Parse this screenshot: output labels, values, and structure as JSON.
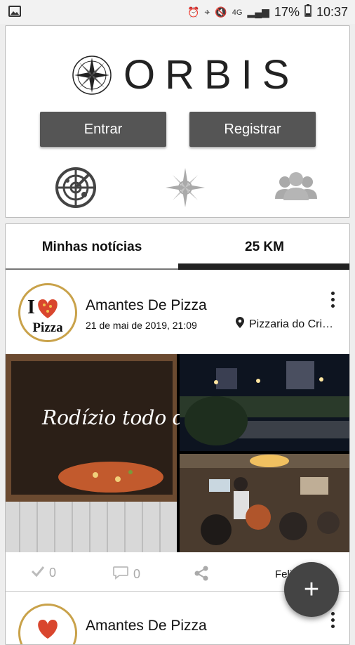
{
  "status_bar": {
    "battery": "17%",
    "time": "10:37",
    "network": "4G"
  },
  "brand": {
    "name": "ORBIS"
  },
  "auth": {
    "login_label": "Entrar",
    "register_label": "Registrar"
  },
  "nav_icons": [
    "radar-icon",
    "compass-rose-icon",
    "group-icon"
  ],
  "tabs": [
    {
      "label": "Minhas notícias",
      "selected": false
    },
    {
      "label": "25 KM",
      "selected": true
    }
  ],
  "posts": [
    {
      "author": "Amantes De Pizza",
      "date": "21 de mai de 2019, 21:09",
      "location": "Pizzaria do Cri…",
      "avatar_text_top": "I",
      "avatar_text_bottom": "Pizza",
      "gallery_overlay": "Rodízio todo dia",
      "likes": "0",
      "comments": "0",
      "trailing_label": "Feli"
    },
    {
      "author": "Amantes De Pizza"
    }
  ],
  "fab_label": "+",
  "colors": {
    "button_bg": "#555555",
    "avatar_ring": "#c9a24a",
    "tab_active": "#222222"
  }
}
